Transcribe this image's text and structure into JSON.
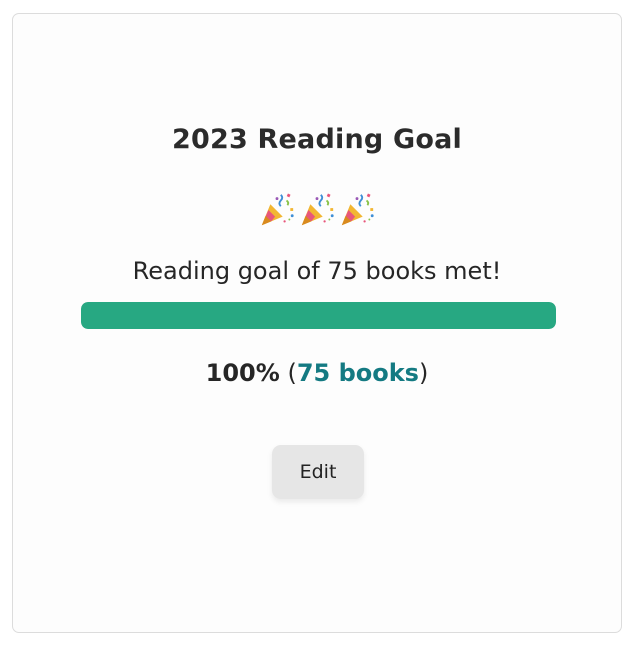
{
  "widget": {
    "title": "2023 Reading Goal",
    "celebration_icons": [
      "party-popper-icon",
      "party-popper-icon",
      "party-popper-icon"
    ],
    "goal_message": "Reading goal of 75 books met!",
    "progress_fraction": 1.0,
    "percent_text": "100%",
    "open_paren": "(",
    "books_link_text": "75 books",
    "close_paren": ")",
    "edit_label": "Edit"
  },
  "colors": {
    "progress_fill": "#27a882",
    "progress_track": "#e4e4e4",
    "books_link": "#147a82",
    "edit_button_bg": "#e6e6e6",
    "text": "#262626"
  }
}
